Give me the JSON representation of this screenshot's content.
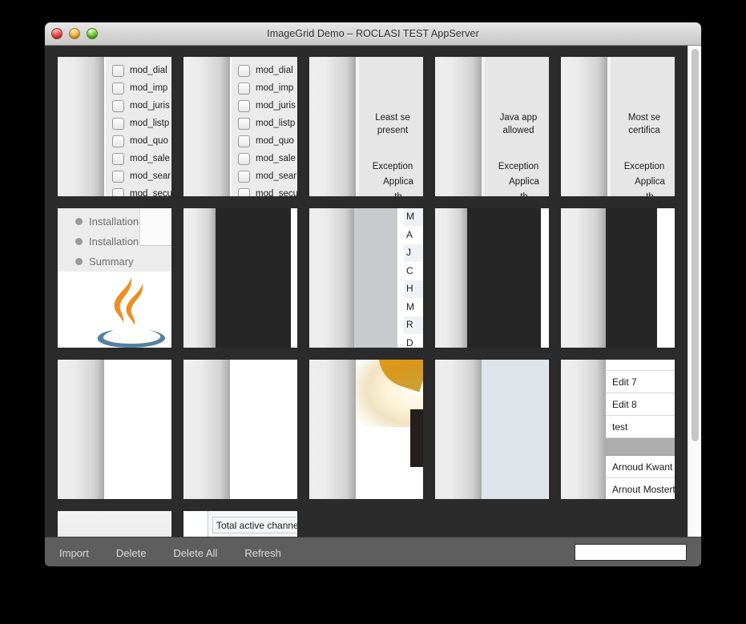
{
  "window": {
    "title": "ImageGrid Demo – ROCLASI TEST AppServer",
    "controls": {
      "close": "close",
      "minimize": "minimize",
      "zoom": "zoom"
    }
  },
  "toolbar": {
    "buttons": [
      "Import",
      "Delete",
      "Delete All",
      "Refresh"
    ],
    "search_value": "",
    "search_placeholder": ""
  },
  "scrollbar": {
    "orientation": "vertical",
    "thumb_position_percent": 0
  },
  "grid": {
    "rows": [
      {
        "cells": [
          {
            "kind": "checkbox-list",
            "items": [
              "mod_dial",
              "mod_imp",
              "mod_juris",
              "mod_listp",
              "mod_quo",
              "mod_sale",
              "mod_sear",
              "mod_secu"
            ]
          },
          {
            "kind": "checkbox-list",
            "items": [
              "mod_dial",
              "mod_imp",
              "mod_juris",
              "mod_listp",
              "mod_quo",
              "mod_sale",
              "mod_sear",
              "mod_secu"
            ]
          },
          {
            "kind": "security-dialog",
            "title_lines": [
              "Least se",
              "present"
            ],
            "body_lines": [
              "Exception",
              "Applica",
              "th"
            ]
          },
          {
            "kind": "security-dialog",
            "title_lines": [
              "Java app",
              "allowed"
            ],
            "body_lines": [
              "Exception",
              "Applica",
              "th"
            ]
          },
          {
            "kind": "security-dialog",
            "title_lines": [
              "Most se",
              "certifica"
            ],
            "body_lines": [
              "Exception",
              "Applica",
              "th"
            ]
          }
        ]
      },
      {
        "cells": [
          {
            "kind": "java-installer",
            "steps": [
              "Installation",
              "Installation",
              "Summary"
            ]
          },
          {
            "kind": "dark-panel"
          },
          {
            "kind": "letter-list",
            "items": [
              "M",
              "A",
              "J",
              "C",
              "H",
              "M",
              "R",
              "D"
            ]
          },
          {
            "kind": "dark-panel"
          },
          {
            "kind": "dark-panel-rows"
          }
        ]
      },
      {
        "cells": [
          {
            "kind": "blank-white"
          },
          {
            "kind": "blank-white"
          },
          {
            "kind": "photo"
          },
          {
            "kind": "bluegray-panel"
          },
          {
            "kind": "name-list",
            "items": [
              "",
              "Edit 7",
              "Edit 8",
              "test",
              "",
              "Arnoud Kwant",
              "Arnout Mostert",
              ""
            ]
          }
        ]
      },
      {
        "cells": [
          {
            "kind": "plain-bar"
          },
          {
            "kind": "field-bar",
            "chip_label": "Total active channels"
          }
        ]
      }
    ]
  }
}
